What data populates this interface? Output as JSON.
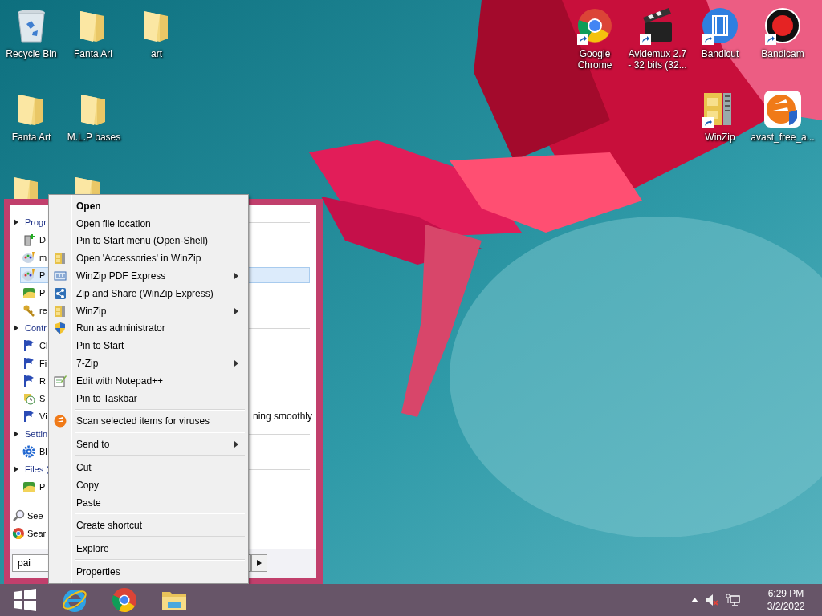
{
  "desktop_icons": [
    {
      "label": "Recycle Bin",
      "kind": "recycle-bin",
      "shortcut": false
    },
    {
      "label": "Fanta Ari",
      "kind": "folder",
      "shortcut": false
    },
    {
      "label": "art",
      "kind": "folder",
      "shortcut": false
    },
    {
      "label": "Google Chrome",
      "kind": "chrome",
      "shortcut": true
    },
    {
      "label": "Avidemux 2.7 - 32 bits (32...",
      "kind": "clapper",
      "shortcut": true
    },
    {
      "label": "Bandicut",
      "kind": "film",
      "shortcut": true
    },
    {
      "label": "Bandicam",
      "kind": "record",
      "shortcut": true
    },
    {
      "label": "Fanta Art",
      "kind": "folder",
      "shortcut": false
    },
    {
      "label": "M.L.P bases",
      "kind": "folder",
      "shortcut": false
    },
    {
      "label": "WinZip",
      "kind": "cabinet",
      "shortcut": true
    },
    {
      "label": "avast_free_a...",
      "kind": "avast",
      "shortcut": false
    },
    {
      "kind": "folder",
      "shortcut": false
    },
    {
      "kind": "folder",
      "shortcut": false
    }
  ],
  "start_menu": {
    "groups": [
      {
        "title": "Progr",
        "items": [
          {
            "label": "D",
            "selected": false
          },
          {
            "label": "m",
            "selected": false
          },
          {
            "label": "P",
            "selected": true
          },
          {
            "label": "P",
            "selected": false
          },
          {
            "label": "re",
            "selected": false
          }
        ]
      },
      {
        "title": "Contr",
        "items": [
          {
            "label": "Cl",
            "selected": false
          },
          {
            "label": "Fi",
            "selected": false
          },
          {
            "label": "R",
            "selected": false
          },
          {
            "label": "S",
            "selected": false
          },
          {
            "label": "Vi",
            "trailing": "ning smoothly",
            "selected": false
          }
        ]
      },
      {
        "title": "Settin",
        "items": [
          {
            "label": "Bl",
            "selected": false
          }
        ]
      },
      {
        "title": "Files (",
        "items": [
          {
            "label": "P",
            "selected": false
          }
        ]
      }
    ],
    "footer": [
      "See",
      "Sear"
    ],
    "search": {
      "value": "pai"
    }
  },
  "context_menu": [
    {
      "kind": "item",
      "label": "Open",
      "default": true,
      "submenu": false
    },
    {
      "kind": "item",
      "label": "Open file location",
      "default": false,
      "submenu": false
    },
    {
      "kind": "item",
      "label": "Pin to Start menu (Open-Shell)",
      "default": false,
      "submenu": false
    },
    {
      "kind": "item",
      "label": "Open 'Accessories' in WinZip",
      "default": false,
      "submenu": false
    },
    {
      "kind": "item",
      "label": "WinZip PDF Express",
      "default": false,
      "submenu": true
    },
    {
      "kind": "item",
      "label": "Zip and Share (WinZip Express)",
      "default": false,
      "submenu": false
    },
    {
      "kind": "item",
      "label": "WinZip",
      "default": false,
      "submenu": true
    },
    {
      "kind": "item",
      "label": "Run as administrator",
      "default": false,
      "submenu": false
    },
    {
      "kind": "item",
      "label": "Pin to Start",
      "default": false,
      "submenu": false
    },
    {
      "kind": "item",
      "label": "7-Zip",
      "default": false,
      "submenu": true
    },
    {
      "kind": "item",
      "label": "Edit with Notepad++",
      "default": false,
      "submenu": false
    },
    {
      "kind": "item",
      "label": "Pin to Taskbar",
      "default": false,
      "submenu": false
    },
    {
      "kind": "separator"
    },
    {
      "kind": "item",
      "label": "Scan selected items for viruses",
      "default": false,
      "submenu": false
    },
    {
      "kind": "separator"
    },
    {
      "kind": "item",
      "label": "Send to",
      "default": false,
      "submenu": true
    },
    {
      "kind": "separator"
    },
    {
      "kind": "item",
      "label": "Cut",
      "default": false,
      "submenu": false
    },
    {
      "kind": "item",
      "label": "Copy",
      "default": false,
      "submenu": false
    },
    {
      "kind": "item",
      "label": "Paste",
      "default": false,
      "submenu": false
    },
    {
      "kind": "separator"
    },
    {
      "kind": "item",
      "label": "Create shortcut",
      "default": false,
      "submenu": false
    },
    {
      "kind": "separator"
    },
    {
      "kind": "item",
      "label": "Explore",
      "default": false,
      "submenu": false
    },
    {
      "kind": "separator"
    },
    {
      "kind": "item",
      "label": "Properties",
      "default": false,
      "submenu": false
    }
  ],
  "taskbar": {
    "clock": {
      "time": "6:29 PM",
      "date": "3/2/2022"
    }
  }
}
